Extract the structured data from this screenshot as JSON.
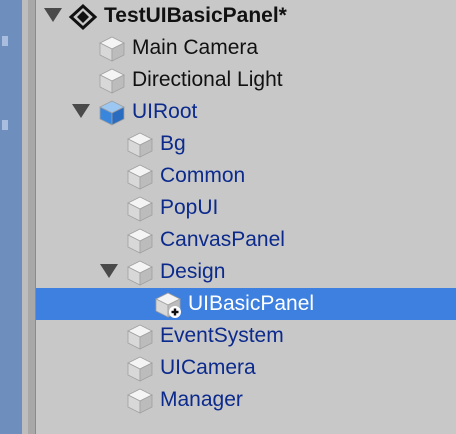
{
  "scene": {
    "title": "TestUIBasicPanel*"
  },
  "objects": [
    {
      "name": "Main Camera",
      "indent": 0,
      "expand": "none",
      "style": "black",
      "cube": "gray"
    },
    {
      "name": "Directional Light",
      "indent": 0,
      "expand": "none",
      "style": "black",
      "cube": "gray"
    },
    {
      "name": "UIRoot",
      "indent": 0,
      "expand": "expanded",
      "style": "blue",
      "cube": "blue"
    },
    {
      "name": "Bg",
      "indent": 1,
      "expand": "none",
      "style": "blue",
      "cube": "gray"
    },
    {
      "name": "Common",
      "indent": 1,
      "expand": "none",
      "style": "blue",
      "cube": "gray"
    },
    {
      "name": "PopUI",
      "indent": 1,
      "expand": "none",
      "style": "blue",
      "cube": "gray"
    },
    {
      "name": "CanvasPanel",
      "indent": 1,
      "expand": "none",
      "style": "blue",
      "cube": "gray"
    },
    {
      "name": "Design",
      "indent": 1,
      "expand": "expanded",
      "style": "blue",
      "cube": "gray"
    },
    {
      "name": "UIBasicPanel",
      "indent": 2,
      "expand": "none",
      "style": "white",
      "cube": "gray-plus",
      "selected": true
    },
    {
      "name": "EventSystem",
      "indent": 1,
      "expand": "none",
      "style": "blue",
      "cube": "gray"
    },
    {
      "name": "UICamera",
      "indent": 1,
      "expand": "none",
      "style": "blue",
      "cube": "gray"
    },
    {
      "name": "Manager",
      "indent": 1,
      "expand": "none",
      "style": "blue",
      "cube": "gray"
    }
  ]
}
